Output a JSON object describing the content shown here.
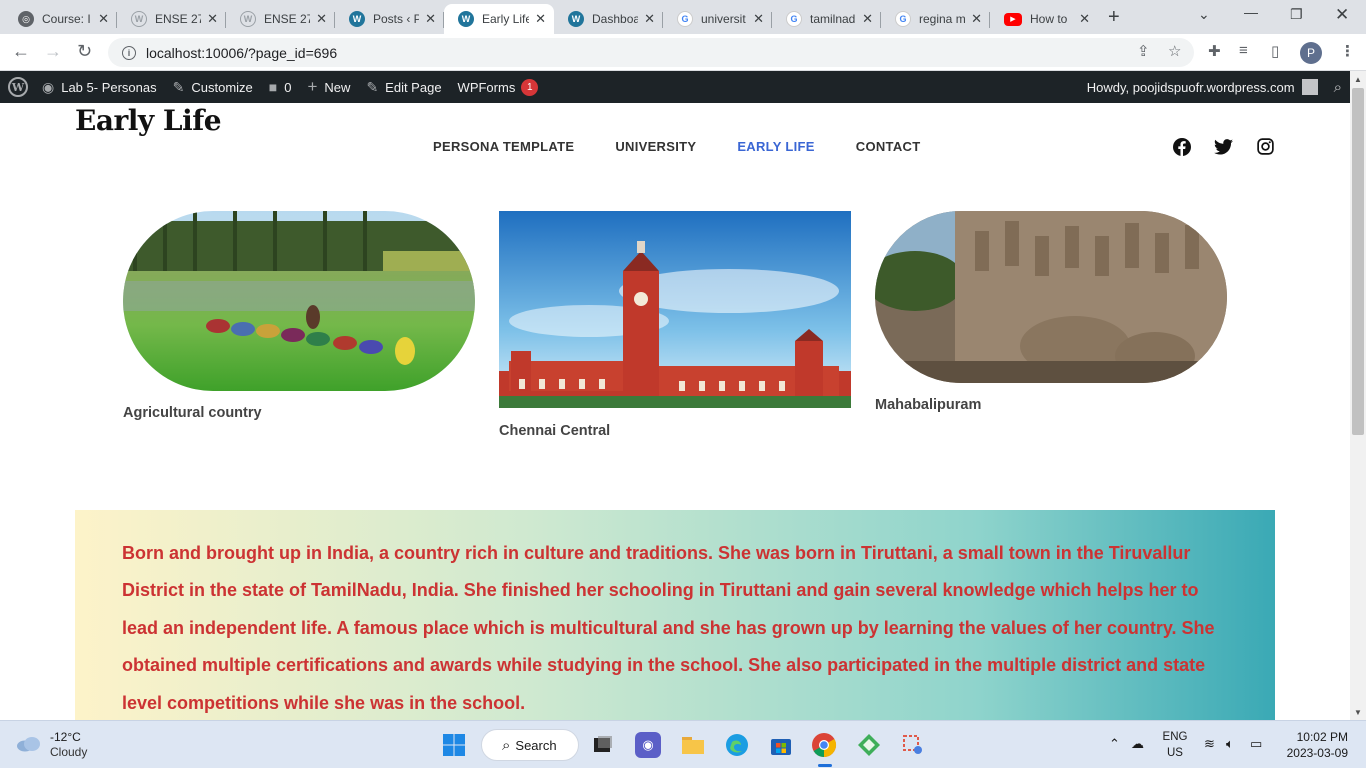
{
  "browser": {
    "tabs": [
      {
        "label": "Course: I",
        "favicon": "globe"
      },
      {
        "label": "ENSE 27",
        "favicon": "wordpress"
      },
      {
        "label": "ENSE 27",
        "favicon": "wordpress"
      },
      {
        "label": "Posts ‹ P",
        "favicon": "wordpress"
      },
      {
        "label": "Early Life",
        "favicon": "wordpress",
        "active": true
      },
      {
        "label": "Dashboa",
        "favicon": "wordpress"
      },
      {
        "label": "universit",
        "favicon": "google"
      },
      {
        "label": "tamilnad",
        "favicon": "google"
      },
      {
        "label": "regina m",
        "favicon": "google"
      },
      {
        "label": "How to",
        "favicon": "youtube"
      }
    ],
    "url": "localhost:10006/?page_id=696",
    "profile_initial": "P"
  },
  "adminbar": {
    "site_name": "Lab 5- Personas",
    "customize": "Customize",
    "comments_count": "0",
    "new_label": "New",
    "edit_page": "Edit Page",
    "wpforms": "WPForms",
    "wpforms_badge": "1",
    "howdy": "Howdy, poojidspuofr.wordpress.com"
  },
  "site": {
    "title": "Early Life",
    "nav": [
      {
        "label": "PERSONA TEMPLATE"
      },
      {
        "label": "UNIVERSITY"
      },
      {
        "label": "EARLY LIFE",
        "current": true
      },
      {
        "label": "CONTACT"
      }
    ],
    "accent_color": "#3a66d4"
  },
  "gallery": [
    {
      "caption": "Agricultural country",
      "image": "rice-field-workers"
    },
    {
      "caption": "Chennai Central",
      "image": "chennai-central-station"
    },
    {
      "caption": "Mahabalipuram",
      "image": "rock-carving-relief"
    }
  ],
  "bio": {
    "text": "Born and brought up in India, a country rich in culture and traditions. She was born in Tiruttani, a small town in the Tiruvallur District in the state of TamilNadu, India. She finished her schooling in Tiruttani and gain several knowledge which helps her to lead an independent life. A famous place which is multicultural and she has grown up by learning the values of her country. She obtained multiple certifications and awards while studying in the school. She also participated in the multiple district and state level competitions while she was in the school.",
    "text_color": "#cc3333"
  },
  "taskbar": {
    "weather_temp": "-12°C",
    "weather_desc": "Cloudy",
    "search_label": "Search",
    "lang_top": "ENG",
    "lang_bottom": "US",
    "time": "10:02 PM",
    "date": "2023-03-09"
  }
}
